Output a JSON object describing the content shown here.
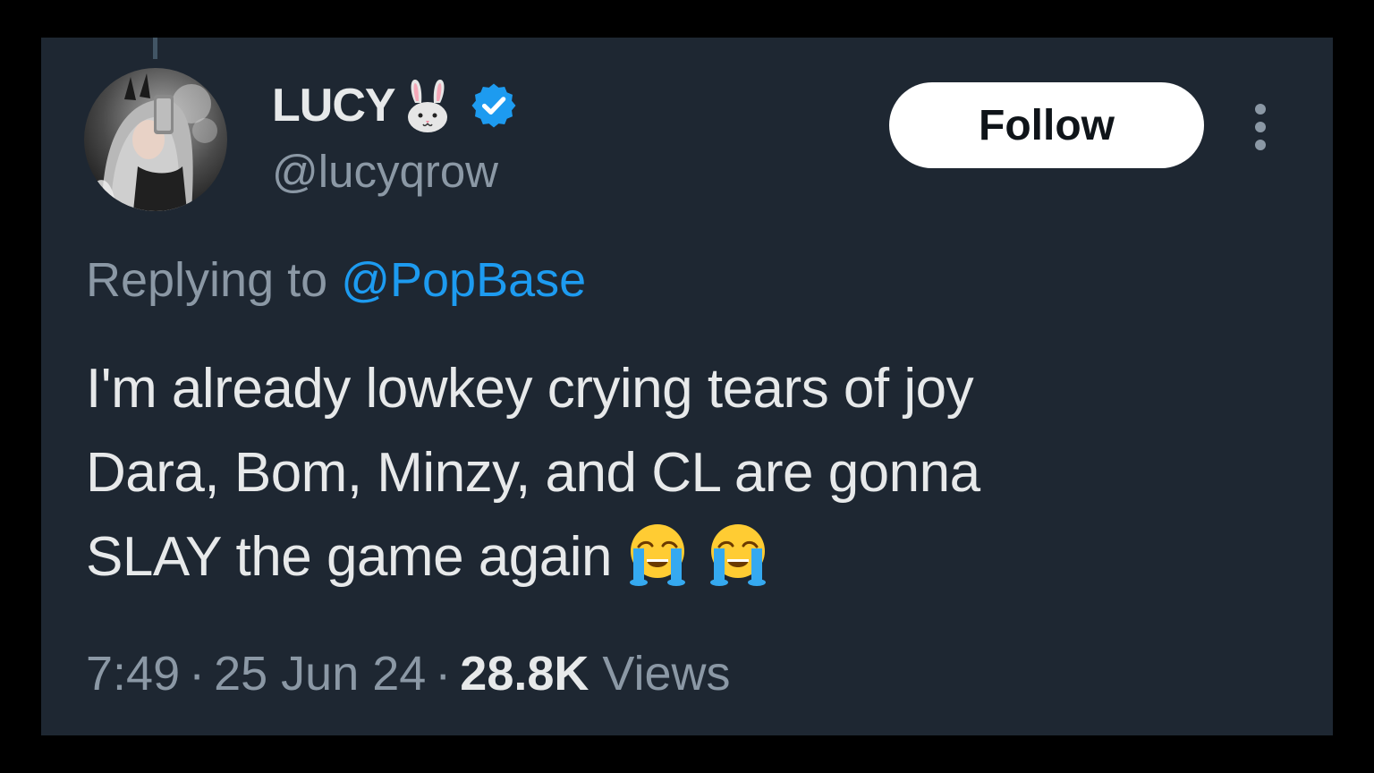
{
  "tweet": {
    "author": {
      "display_name": "LUCY",
      "name_emoji": "rabbit-face-icon",
      "verified": true,
      "handle": "@lucyqrow"
    },
    "follow_label": "Follow",
    "replying_prefix": "Replying to",
    "replying_to": "@PopBase",
    "text_lines": [
      "I'm already lowkey crying tears of joy",
      "Dara, Bom, Minzy, and CL are gonna",
      "SLAY the game again"
    ],
    "trailing_emojis": [
      "loudly-crying-face-icon",
      "loudly-crying-face-icon"
    ],
    "time": "7:49",
    "separator": "·",
    "date": "25 Jun 24",
    "views_count": "28.8K",
    "views_label": "Views"
  },
  "colors": {
    "background": "#1e2732",
    "outer_border": "#000000",
    "primary_text": "#e7e9ea",
    "secondary_text": "#8b98a5",
    "link": "#1d9bf0",
    "follow_button_bg": "#ffffff",
    "verified_badge": "#1d9bf0"
  }
}
